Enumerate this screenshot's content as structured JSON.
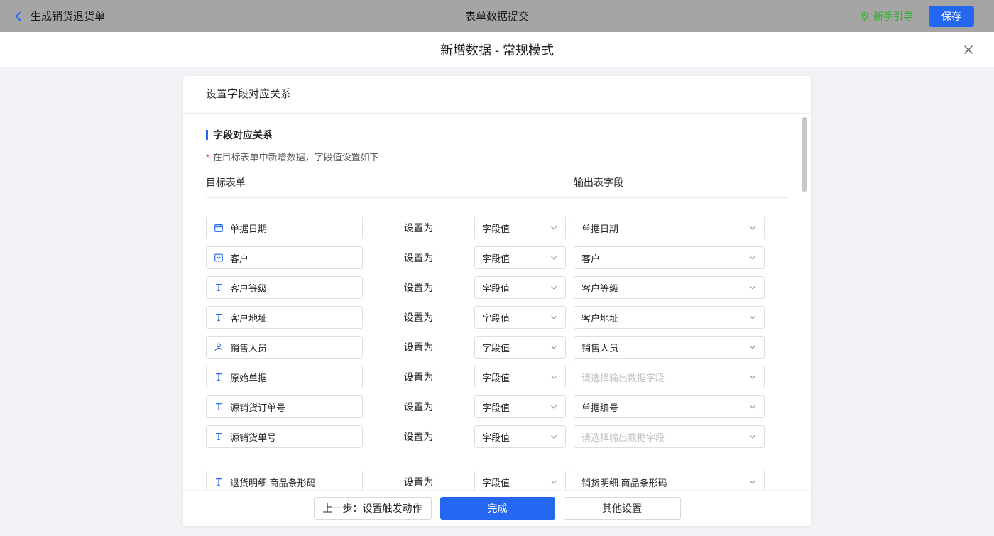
{
  "topbar": {
    "back_label": "生成销货退货单",
    "title": "表单数据提交",
    "guide_label": "新手引导",
    "save_label": "保存"
  },
  "dialog": {
    "title": "新增数据 - 常规模式"
  },
  "card": {
    "header": "设置字段对应关系",
    "section_title": "字段对应关系",
    "required_mark": "*",
    "section_note": "在目标表单中新增数据，字段值设置如下",
    "col_left": "目标表单",
    "col_right": "输出表字段",
    "set_as": "设置为",
    "rows": [
      {
        "icon": "date",
        "field": "单据日期",
        "mode": "字段值",
        "output": "单据日期",
        "placeholder": false
      },
      {
        "icon": "select",
        "field": "客户",
        "mode": "字段值",
        "output": "客户",
        "placeholder": false
      },
      {
        "icon": "text",
        "field": "客户等级",
        "mode": "字段值",
        "output": "客户等级",
        "placeholder": false
      },
      {
        "icon": "text",
        "field": "客户地址",
        "mode": "字段值",
        "output": "客户地址",
        "placeholder": false
      },
      {
        "icon": "user",
        "field": "销售人员",
        "mode": "字段值",
        "output": "销售人员",
        "placeholder": false
      },
      {
        "icon": "text",
        "field": "原始单据",
        "mode": "字段值",
        "output": "请选择输出数据字段",
        "placeholder": true
      },
      {
        "icon": "text",
        "field": "源销货订单号",
        "mode": "字段值",
        "output": "单据编号",
        "placeholder": false
      },
      {
        "icon": "text",
        "field": "源销货单号",
        "mode": "字段值",
        "output": "请选择输出数据字段",
        "placeholder": true
      },
      {
        "icon": "text",
        "field": "退货明细.商品条形码",
        "mode": "字段值",
        "output": "销货明细.商品条形码",
        "placeholder": false,
        "group_gap": true
      }
    ],
    "footer": {
      "prev_label": "上一步：设置触发动作",
      "done_label": "完成",
      "other_label": "其他设置"
    }
  },
  "colors": {
    "accent": "#2468f2",
    "success_green": "#2bb324",
    "topbar_bg": "#a5a5a5",
    "page_bg": "#f0f2f5",
    "placeholder_text": "#bfbfbf",
    "required_red": "#e63030"
  }
}
